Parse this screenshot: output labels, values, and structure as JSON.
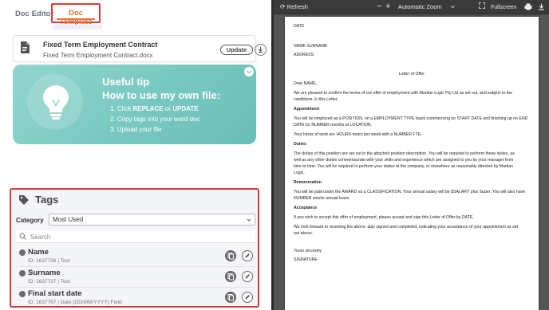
{
  "left": {
    "tabs": {
      "editor": "Doc Editor",
      "template": "Doc Template"
    },
    "doc_card": {
      "title": "Fixed Term Employment Contract",
      "file": "Fixed Term Employment Contract.docx",
      "update": "Update"
    },
    "tip": {
      "title1": "Useful tip",
      "title2": "How to use my own file:",
      "step1_prefix": "1. Click ",
      "step1_b1": "REPLACE",
      "step1_mid": " or ",
      "step1_b2": "UPDATE",
      "step2": "2. Copy tags into your word doc",
      "step3": "3. Upload your file"
    },
    "tags": {
      "title": "Tags",
      "category_label": "Category",
      "category_value": "Most Used",
      "search_placeholder": "Search",
      "items": [
        {
          "name": "Name",
          "meta": "ID: 1637736 | Text"
        },
        {
          "name": "Surname",
          "meta": "ID: 1637737 | Text"
        },
        {
          "name": "Final start date",
          "meta": "ID: 1637767 | Date (DD/MM/YYYY) Field"
        }
      ]
    }
  },
  "viewer": {
    "toolbar": {
      "refresh": "Refresh",
      "minus": "−",
      "plus": "+",
      "zoom": "Automatic Zoom",
      "fullscreen": "Fullscreen"
    },
    "page": {
      "date": "DATE",
      "name": "NAME SURNAME",
      "address": "ADDRESS",
      "heading": "Letter of Offer",
      "salutation": "Dear NAME,",
      "intro1": "We are pleased to confirm the terms of our offer of employment with Martian Logic Pty Ltd as set out, and subject to the",
      "intro2": "conditions, in this Letter.",
      "h_appointment": "Appointment",
      "appt1": "You will be employed as a POSITION, on a EMPLOYMENT TYPE basis commencing on START DATE and finishing up on END",
      "appt2": "DATE for NUMBER months at LOCATION.",
      "hours": "Your hours of work are HOURS hours per week with a NUMBER FTE.",
      "h_duties": "Duties",
      "duties1": "The duties of this position are set out in the attached position description. You will be required to perform these duties, as",
      "duties2": "well as any other duties commensurate with your skills and experience which are assigned to you by your manager from",
      "duties3": "time to time. You will be required to perform your duties at the company, or elsewhere as reasonably directed by Martian",
      "duties4": "Logic.",
      "h_remuneration": "Remuneration",
      "rem1": "You will be paid under the AWARD as a CLASSIFICATION. Your annual salary will be $SALARY plus Super. You will also have",
      "rem2": "NUMBER weeks annual leave.",
      "h_acceptance": "Acceptance",
      "acc1": "If you wish to accept this offer of employment, please accept and sign this Letter of Offer by DATE.",
      "acc2": "We look forward to receiving the above, duly signed and completed, indicating your acceptance of your appointment as set",
      "acc3": "out above.",
      "closing": "Yours sincerely",
      "signature": "SIGNATURE"
    }
  },
  "colors": {
    "accent": "#e8743b",
    "highlight_border": "#d93a3a",
    "tip_bg": "#7ccac2",
    "viewer_bg": "#555555"
  }
}
